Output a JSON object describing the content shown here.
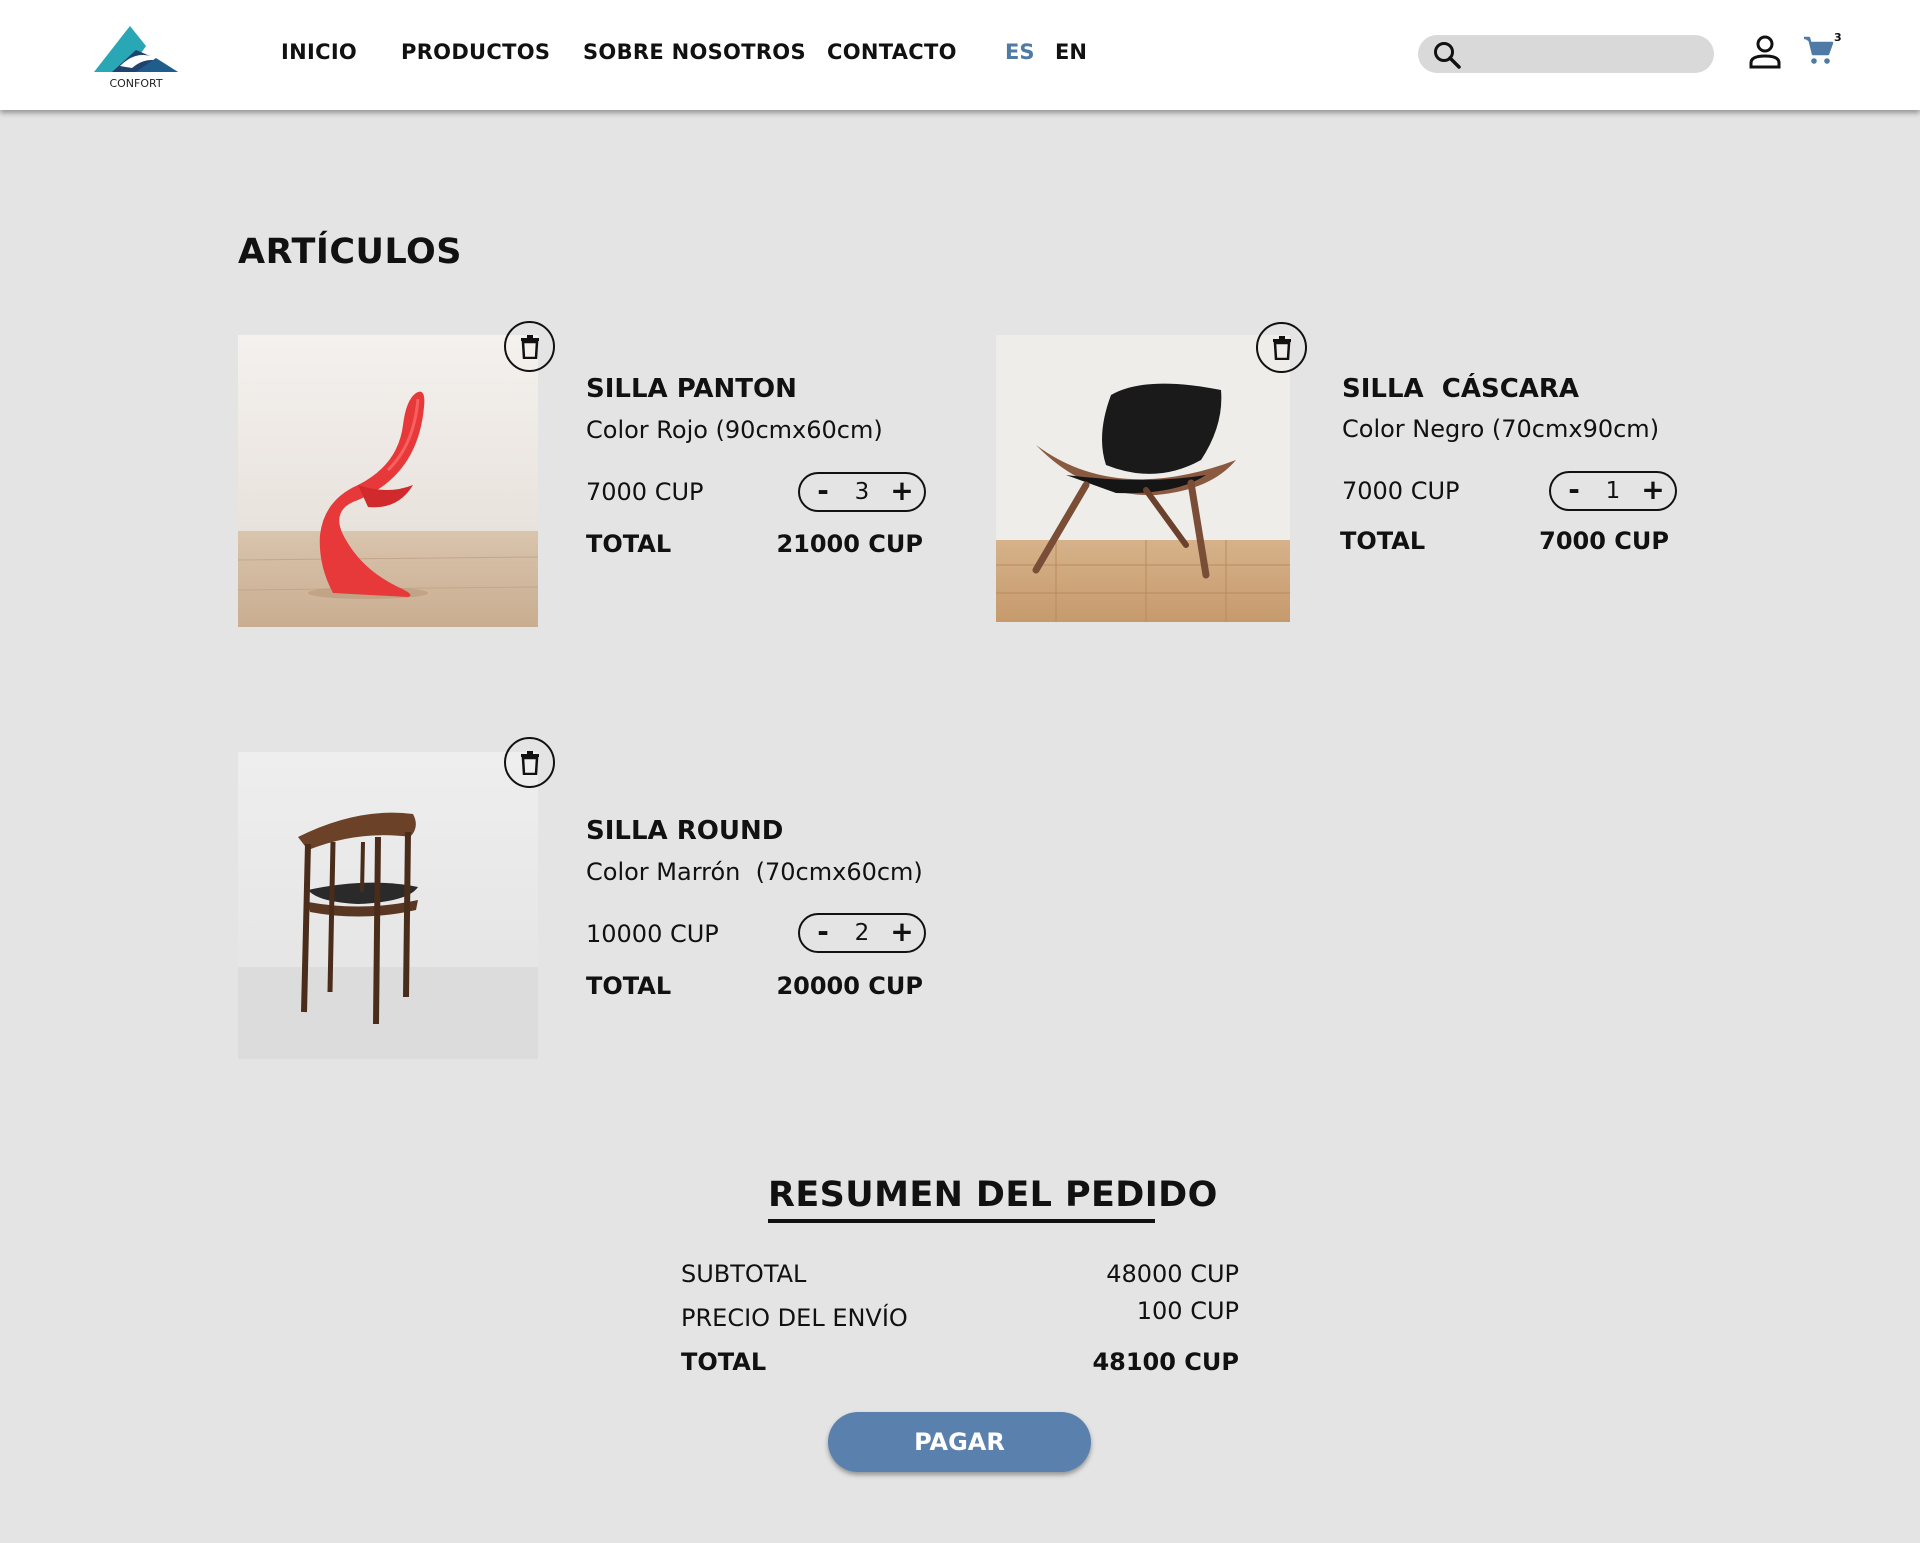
{
  "brand": {
    "name": "CONFORT",
    "colors": {
      "teal": "#2aa7b4",
      "navy": "#20436e"
    }
  },
  "nav": {
    "items": [
      {
        "label": "INICIO"
      },
      {
        "label": "PRODUCTOS"
      },
      {
        "label": "SOBRE NOSOTROS"
      },
      {
        "label": "CONTACTO"
      }
    ],
    "languages": [
      {
        "label": "ES",
        "active": true
      },
      {
        "label": "EN",
        "active": false
      }
    ]
  },
  "search": {
    "placeholder": "",
    "value": "",
    "icon": "search-icon"
  },
  "header_icons": {
    "user": "user-icon",
    "cart": "cart-icon",
    "cart_count": "3"
  },
  "articles": {
    "title": "ARTÍCULOS",
    "items": [
      {
        "name": "SILLA PANTON",
        "description": "Color Rojo (90cmx60cm)",
        "price": "7000 CUP",
        "quantity": "3",
        "total_label": "TOTAL",
        "total": "21000 CUP",
        "image": "red-panton-chair"
      },
      {
        "name": "SILLA  CÁSCARA",
        "description": "Color Negro (70cmx90cm)",
        "price": "7000 CUP",
        "quantity": "1",
        "total_label": "TOTAL",
        "total": "7000 CUP",
        "image": "black-shell-chair"
      },
      {
        "name": "SILLA ROUND",
        "description": "Color Marrón  (70cmx60cm)",
        "price": "10000 CUP",
        "quantity": "2",
        "total_label": "TOTAL",
        "total": "20000 CUP",
        "image": "brown-round-chair"
      }
    ],
    "stepper": {
      "minus": "-",
      "plus": "+"
    }
  },
  "summary": {
    "title": "RESUMEN DEL PEDIDO",
    "subtotal_label": "SUBTOTAL",
    "subtotal": "48000 CUP",
    "shipping_label": "PRECIO DEL ENVÍO",
    "shipping": "100 CUP",
    "total_label": "TOTAL",
    "total": "48100 CUP",
    "pay_label": "PAGAR",
    "pay_color": "#5a81ad"
  }
}
